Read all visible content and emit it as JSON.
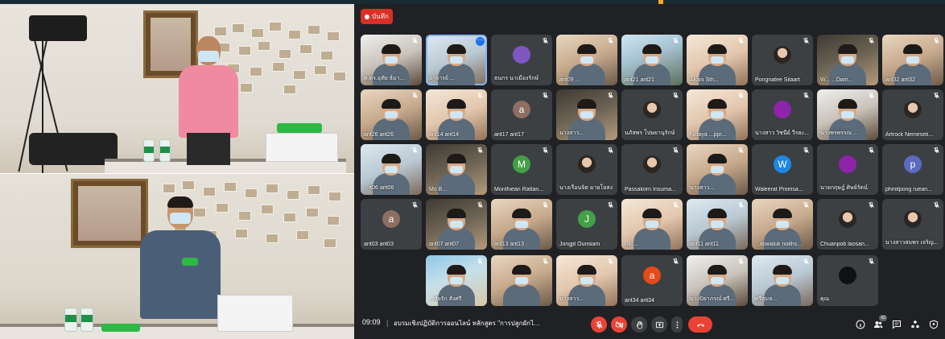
{
  "record": {
    "label": "บันทึก"
  },
  "colors": {
    "record_red": "#d93025",
    "active_border": "#8ab4f8",
    "end_call_red": "#ea4335"
  },
  "participants": [
    [
      "ค.ดร.อุทัย ธ์มา...",
      "อาจารย์ ...",
      "ธนกร นาเมืองรักษ์",
      "arit09 ...",
      "arit21 arit21",
      "Akani Sth...",
      "Pongnatee Silaart",
      "W... ...Dam...",
      "arit32 arit32"
    ],
    [
      "arit26 arit26",
      "arit14 arit14",
      "arit17 arit17",
      "นางสาว...",
      "นภัสพร โปษยานุรักษ์",
      "Nittaya ...ppr...",
      "นางสาว วิชนีย์ วีรยะ...",
      "นางพรพรรณ ...",
      "Artrock Nemeseli..."
    ],
    [
      "...ธ06 arit06",
      "Mo B...",
      "Monthiean Rattan...",
      "นางเรือนจิต มายโยสง",
      "Passakorn Insuma...",
      "นางสาว...",
      "Waleerat Promsa...",
      "นายกฤษฎ์ ศิษย์รัตน์",
      "phinitpong ruean..."
    ],
    [
      "arit03 arit03",
      "arit07 arit07",
      "arit13 arit13",
      "Jongjit Ounsiam",
      "Bb ...",
      "arit11 arit11",
      "...aowaluk noiths...",
      "Chuanpob laosan...",
      "นางสาวสมพร เจริญ..."
    ],
    [
      "...ชัยรัก สังศรี",
      "...",
      "นางสาว...",
      "arit34 arit34",
      "นางปิยาภรณ์ ศรี...",
      "ศรีสุมล...",
      "คุณ"
    ]
  ],
  "avatar_letters": {
    "ธนกร": "",
    "arit17": "a",
    "Monthiean": "M",
    "Waleerat": "W",
    "phinitpong": "p",
    "arit03": "a",
    "Jongjit": "J",
    "arit34": "a"
  },
  "bottom": {
    "time": "09:09",
    "separator": "|",
    "meeting_title": "อบรมเชิงปฏิบัติการออนไลน์ หลักสูตร \"การปลูกผักไฮโดรโ...",
    "people_count": "43"
  },
  "controls": {
    "mic": "mic-off-icon",
    "cam": "videocam-off-icon",
    "hand": "raise-hand-icon",
    "present": "present-screen-icon",
    "more": "more-options-icon",
    "end": "call-end-icon"
  },
  "right_icons": [
    "info-icon",
    "people-icon",
    "chat-icon",
    "activities-icon",
    "host-controls-icon"
  ]
}
